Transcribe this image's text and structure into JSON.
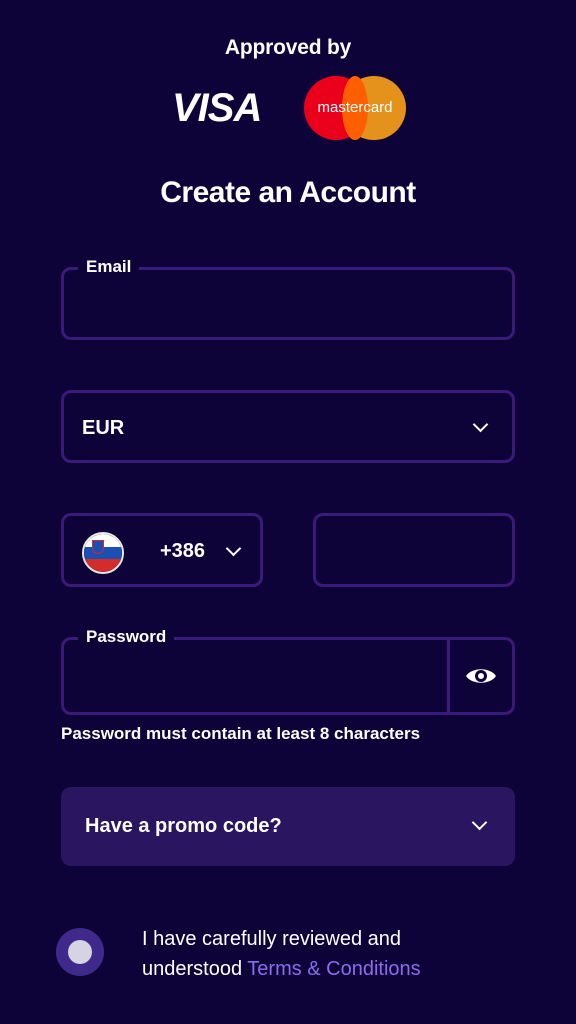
{
  "header": {
    "approved_text": "Approved by",
    "visa_text": "VISA",
    "mastercard_text": "mastercard"
  },
  "form": {
    "title": "Create an Account",
    "email": {
      "label": "Email",
      "value": ""
    },
    "currency": {
      "value": "EUR"
    },
    "phone": {
      "country_code": "+386",
      "number": "",
      "flag": "slovenia-flag-icon"
    },
    "password": {
      "label": "Password",
      "value": "",
      "hint": "Password must contain at least 8 characters"
    },
    "promo": {
      "label": "Have a promo code?"
    },
    "terms": {
      "text": "I have carefully reviewed and understood ",
      "link": "Terms & Conditions"
    }
  },
  "colors": {
    "background": "#0e0338",
    "border": "#3a1a7a",
    "promo_bg": "#2a1560",
    "link": "#8b6cf0"
  }
}
